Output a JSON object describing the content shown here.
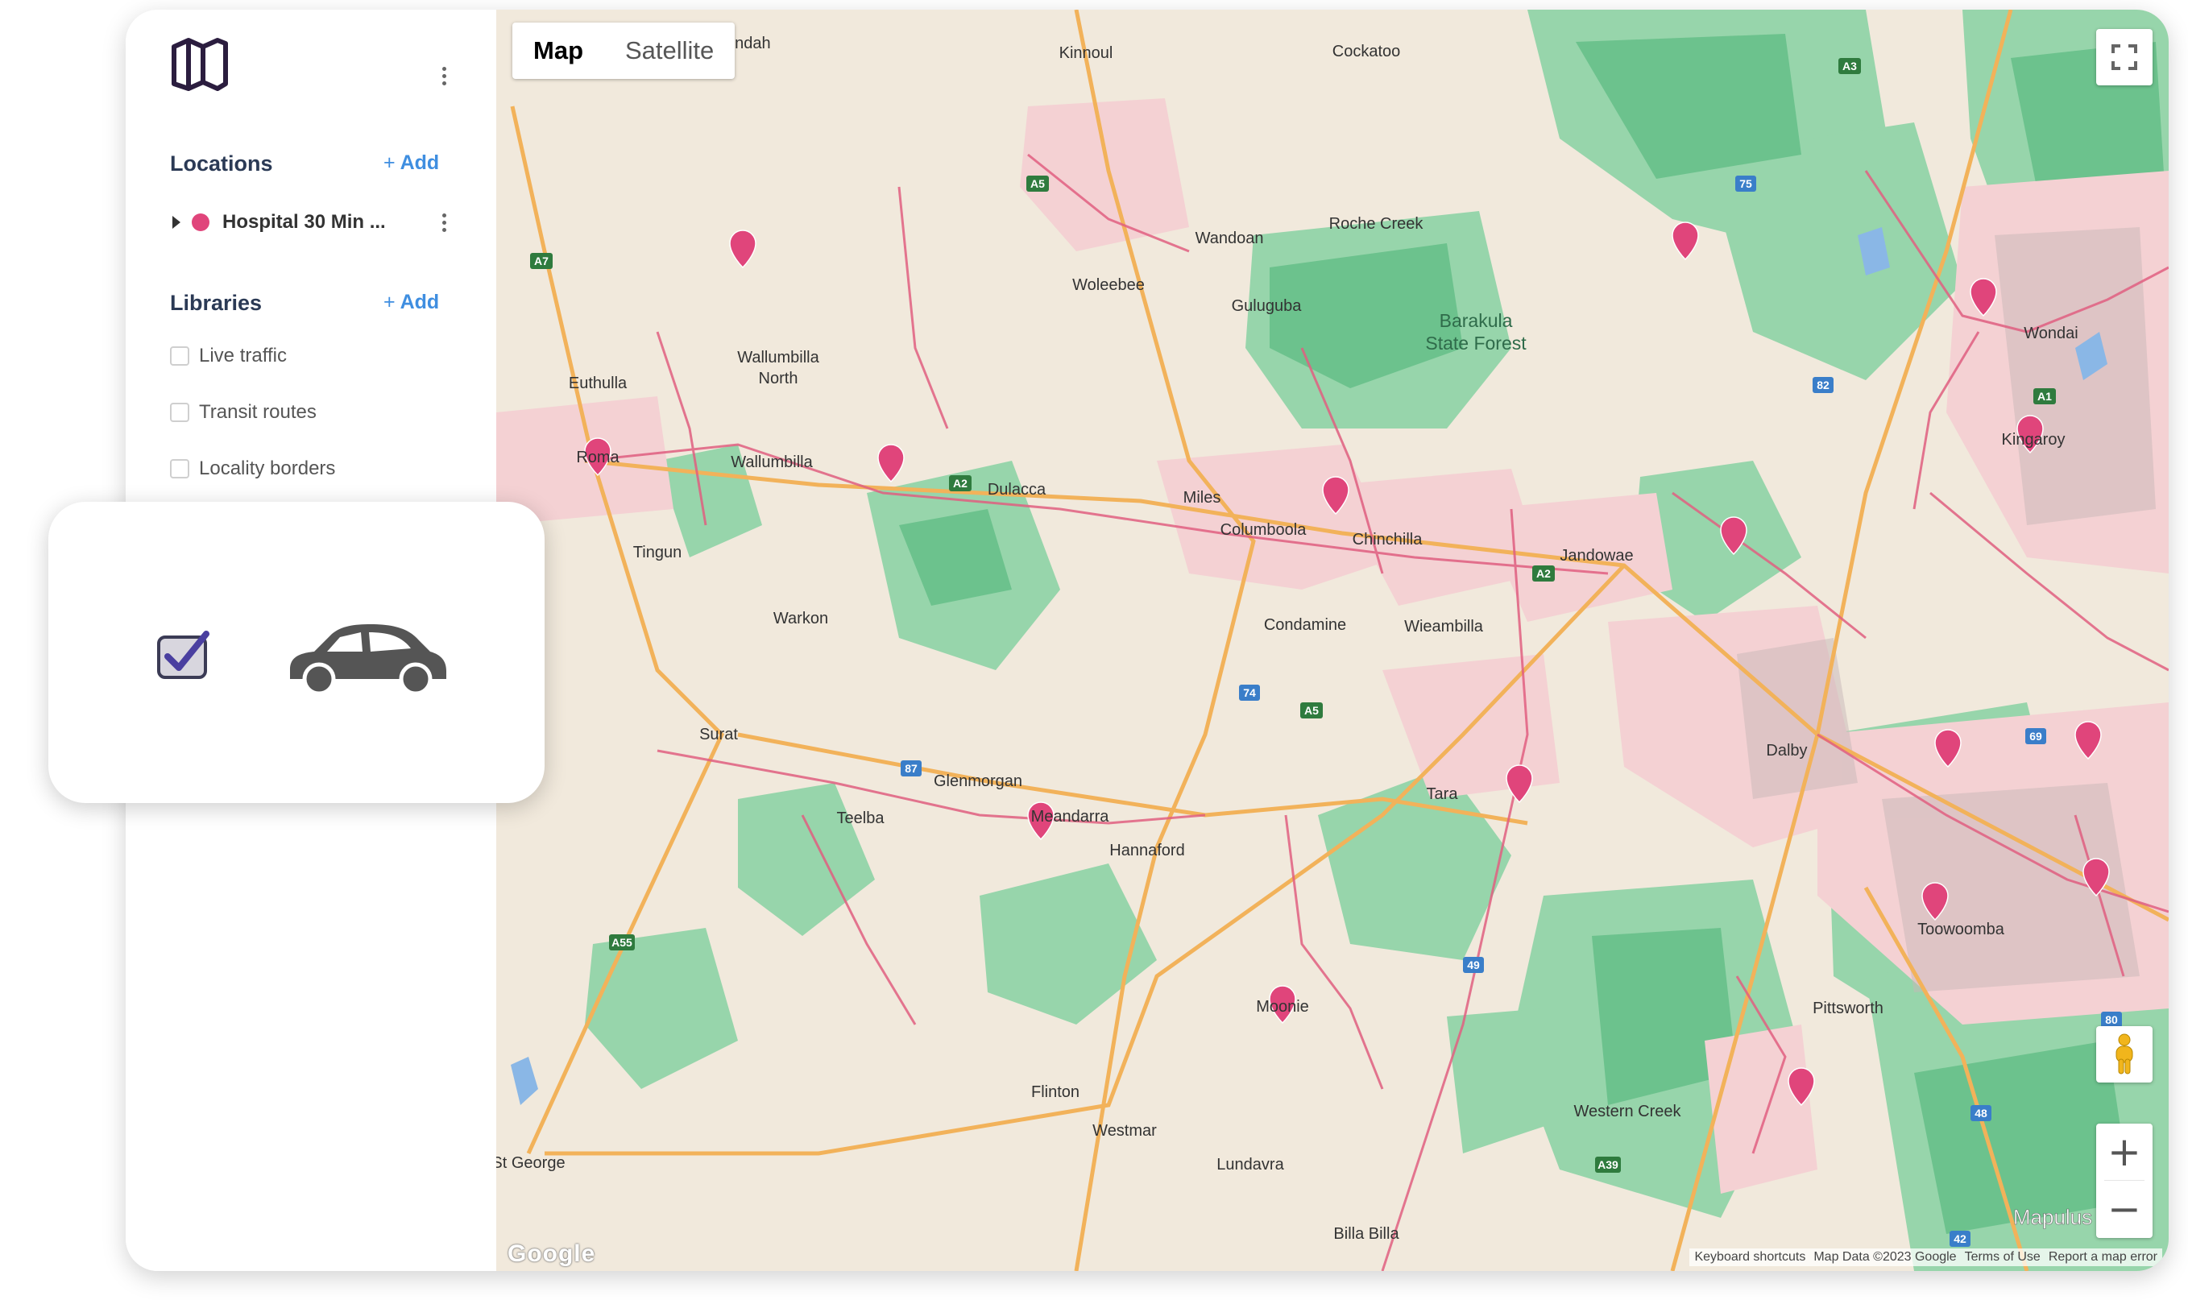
{
  "sidebar": {
    "logo_icon": "folded-map-icon",
    "locations": {
      "title": "Locations",
      "add_label": "Add",
      "items": [
        {
          "label": "Hospital 30 Min ...",
          "color": "#e0457b"
        }
      ]
    },
    "libraries": {
      "title": "Libraries",
      "add_label": "Add",
      "items": [
        {
          "label": "Live traffic"
        },
        {
          "label": "Transit routes"
        },
        {
          "label": "Locality borders"
        }
      ]
    }
  },
  "map": {
    "type_buttons": {
      "map": "Map",
      "satellite": "Satellite",
      "selected": "Map"
    },
    "places": [
      "Roondah",
      "Kinnoul",
      "Cockatoo",
      "Wandoan",
      "Roche Creek",
      "Woleebee",
      "Guluguba",
      "Barakula",
      "State Forest",
      "Wondai",
      "Kingaroy",
      "Wallumbilla",
      "North",
      "Euthulla",
      "Roma",
      "Wallumbilla",
      "Dulacca",
      "Miles",
      "Columboola",
      "Chinchilla",
      "Jandowae",
      "Tingun",
      "Warkon",
      "Condamine",
      "Wieambilla",
      "Surat",
      "Glenmorgan",
      "Meandarra",
      "Teelba",
      "Hannaford",
      "Tara",
      "Dalby",
      "Toowoomba",
      "Pittsworth",
      "Moonie",
      "Western Creek",
      "Flinton",
      "Westmar",
      "Lundavra",
      "Billa Billa",
      "St George",
      "Mapulus"
    ],
    "road_shields": [
      "A5",
      "A7",
      "A2",
      "A55",
      "A39",
      "A3",
      "A1",
      "74",
      "75",
      "82",
      "87",
      "49",
      "42",
      "48",
      "69",
      "80",
      "A5",
      "A2"
    ],
    "attribution": {
      "shortcuts": "Keyboard shortcuts",
      "data": "Map Data ©2023 Google",
      "terms": "Terms of Use",
      "report": "Report a map error"
    },
    "google_logo": "Google",
    "controls": {
      "fullscreen_icon": "fullscreen-icon",
      "pegman_icon": "pegman-icon",
      "zoom_in": "+",
      "zoom_out": "−"
    },
    "colors": {
      "land": "#f1e9dc",
      "forest": "#97d5ab",
      "forest_dark": "#6cc28d",
      "urban": "#f4d1d3",
      "road": "#e05f80",
      "highway": "#f2b25a",
      "water": "#8ab7e6",
      "marker": "#e0457b"
    }
  },
  "callout": {
    "checkbox_checked": true,
    "car_icon": "car-icon"
  }
}
